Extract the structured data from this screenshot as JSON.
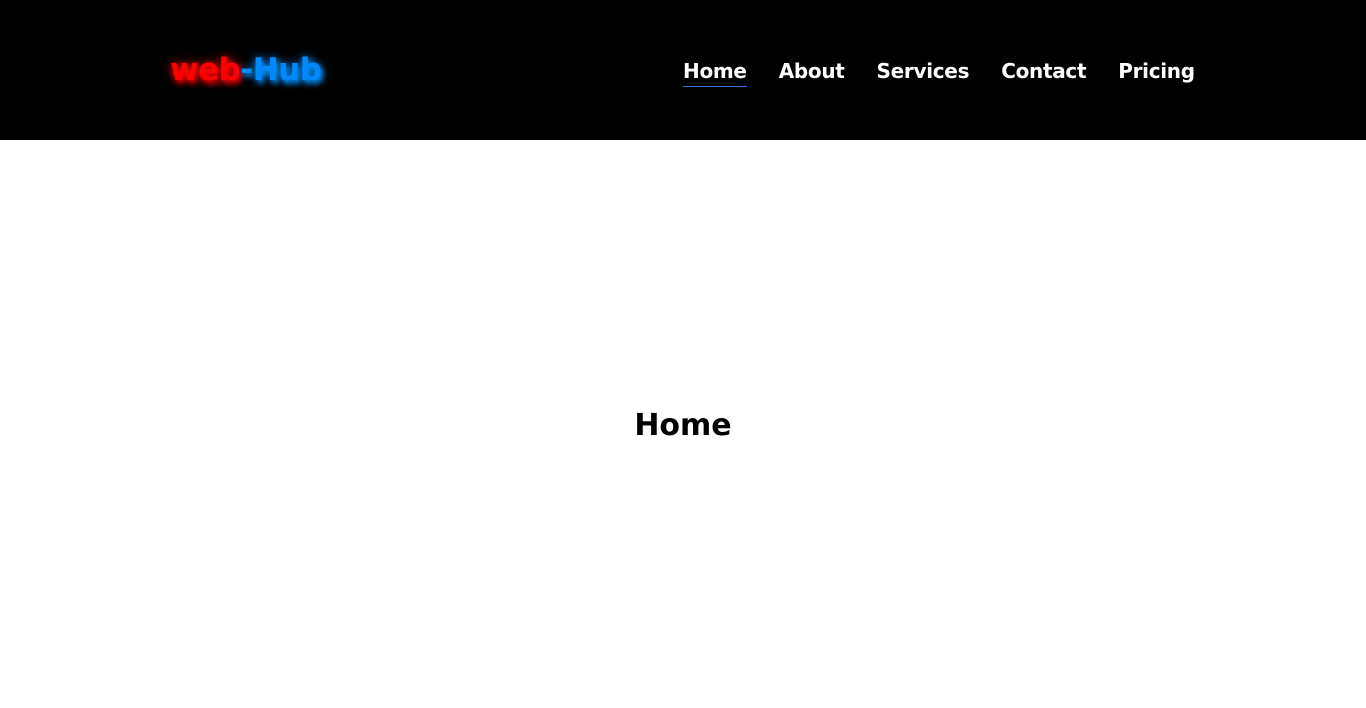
{
  "logo": {
    "part1": "web",
    "part2": "-Hub",
    "part1_color": "#ff0000",
    "part2_color": "#0088ff"
  },
  "nav": {
    "items": [
      {
        "label": "Home",
        "active": true
      },
      {
        "label": "About",
        "active": false
      },
      {
        "label": "Services",
        "active": false
      },
      {
        "label": "Contact",
        "active": false
      },
      {
        "label": "Pricing",
        "active": false
      }
    ],
    "active_underline_color": "#3b6fe0"
  },
  "main": {
    "title": "Home"
  }
}
